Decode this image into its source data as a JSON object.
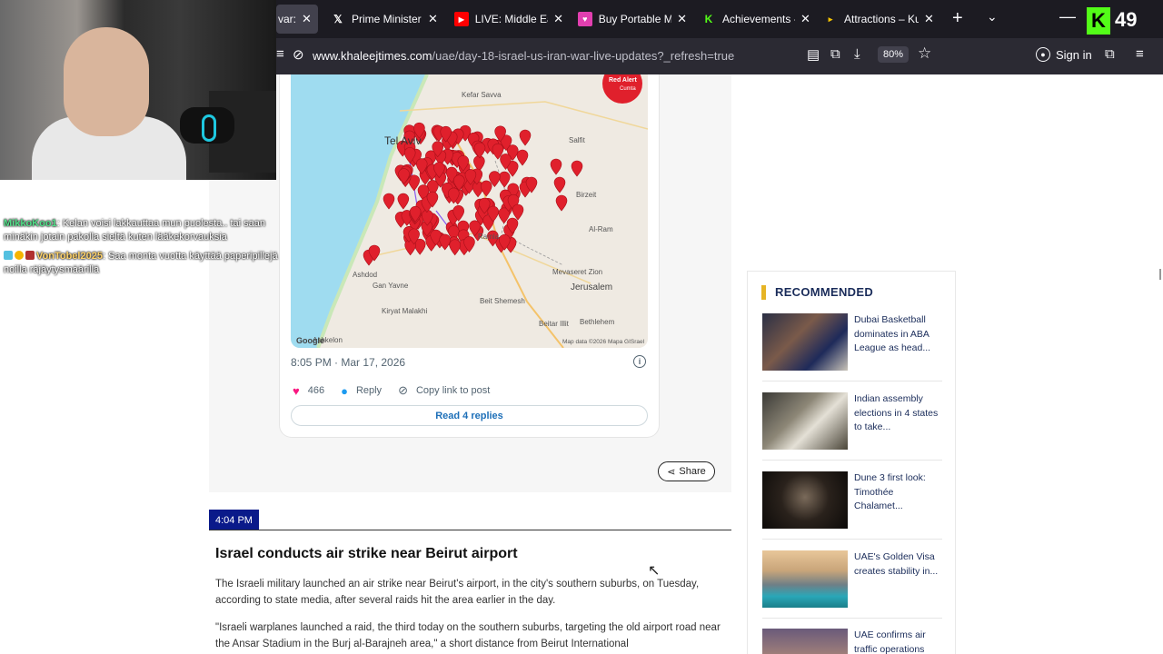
{
  "browser": {
    "tabs": [
      {
        "label": "var: T",
        "favicon": "generic",
        "active": true
      },
      {
        "label": "Prime Minister c",
        "favicon": "x-icon",
        "active": false
      },
      {
        "label": "LIVE: Middle Eas",
        "favicon": "youtube-icon",
        "active": false
      },
      {
        "label": "Buy Portable Mc",
        "favicon": "store-icon",
        "active": false
      },
      {
        "label": "Achievements -",
        "favicon": "kick-icon",
        "active": false
      },
      {
        "label": "Attractions – Ku",
        "favicon": "flag-icon",
        "active": false
      }
    ],
    "new_tab_glyph": "+",
    "url_domain": "www.khaleejtimes.com",
    "url_path": "/uae/day-18-israel-us-iran-war-live-updates?_refresh=true",
    "zoom": "80%",
    "sign_in": "Sign in"
  },
  "stream_overlay": {
    "kick_count": "49",
    "chat": [
      {
        "user": "MikkoKoo1",
        "text": "Kelan voisi lakkauttaa mun puolesta.. tai saan minäkin jotain pakolla sieltä kuten lääkekorvauksia"
      },
      {
        "user": "VonTobel2025",
        "text": "Saa monta vuotta käyttää paperipillejä noilla räjäytysmäärillä"
      }
    ]
  },
  "tweet": {
    "map_labels": [
      "Kefar Savva",
      "Tel Aviv",
      "Salfit",
      "Birzeit",
      "Ramla",
      "Al-Ram",
      "Mevaseret Zion",
      "Jerusalem",
      "Ashdod",
      "Gan Yavne",
      "Kiryat Malakhi",
      "Beit Shemesh",
      "Beitar Illit",
      "Bethlehem",
      "Ashkelon"
    ],
    "map_badge": "Red Alert",
    "map_badge_sub": "Cumta",
    "map_footer": "Map data ©2026 Mapa GISrael",
    "map_brand": "Google",
    "timestamp": "8:05 PM · Mar 17, 2026",
    "likes": "466",
    "reply_label": "Reply",
    "copy_label": "Copy link to post",
    "read_replies": "Read 4 replies"
  },
  "share_label": "Share",
  "update": {
    "time": "4:04 PM",
    "headline": "Israel conducts air strike near Beirut airport",
    "para1": "The Israeli military launched an air strike near Beirut's airport, in the city's southern suburbs, on Tuesday, according to state media, after several raids hit the area earlier in the day.",
    "para2": "\"Israeli warplanes launched a raid, the third today on the southern suburbs, targeting the old airport road near the Ansar Stadium in the Burj al-Barajneh area,\" a short distance from Beirut International"
  },
  "recommended": {
    "title": "RECOMMENDED",
    "items": [
      {
        "text": "Dubai Basketball dominates in ABA League as head..."
      },
      {
        "text": "Indian assembly elections in 4 states to take..."
      },
      {
        "text": "Dune 3 first look: Timothée Chalamet..."
      },
      {
        "text": "UAE's Golden Visa creates stability in..."
      },
      {
        "text": "UAE confirms air traffic operations"
      }
    ]
  },
  "colors": {
    "accent_navy": "#0a1a8a",
    "rec_bar": "#e6b425",
    "alert_red": "#e0202c"
  }
}
